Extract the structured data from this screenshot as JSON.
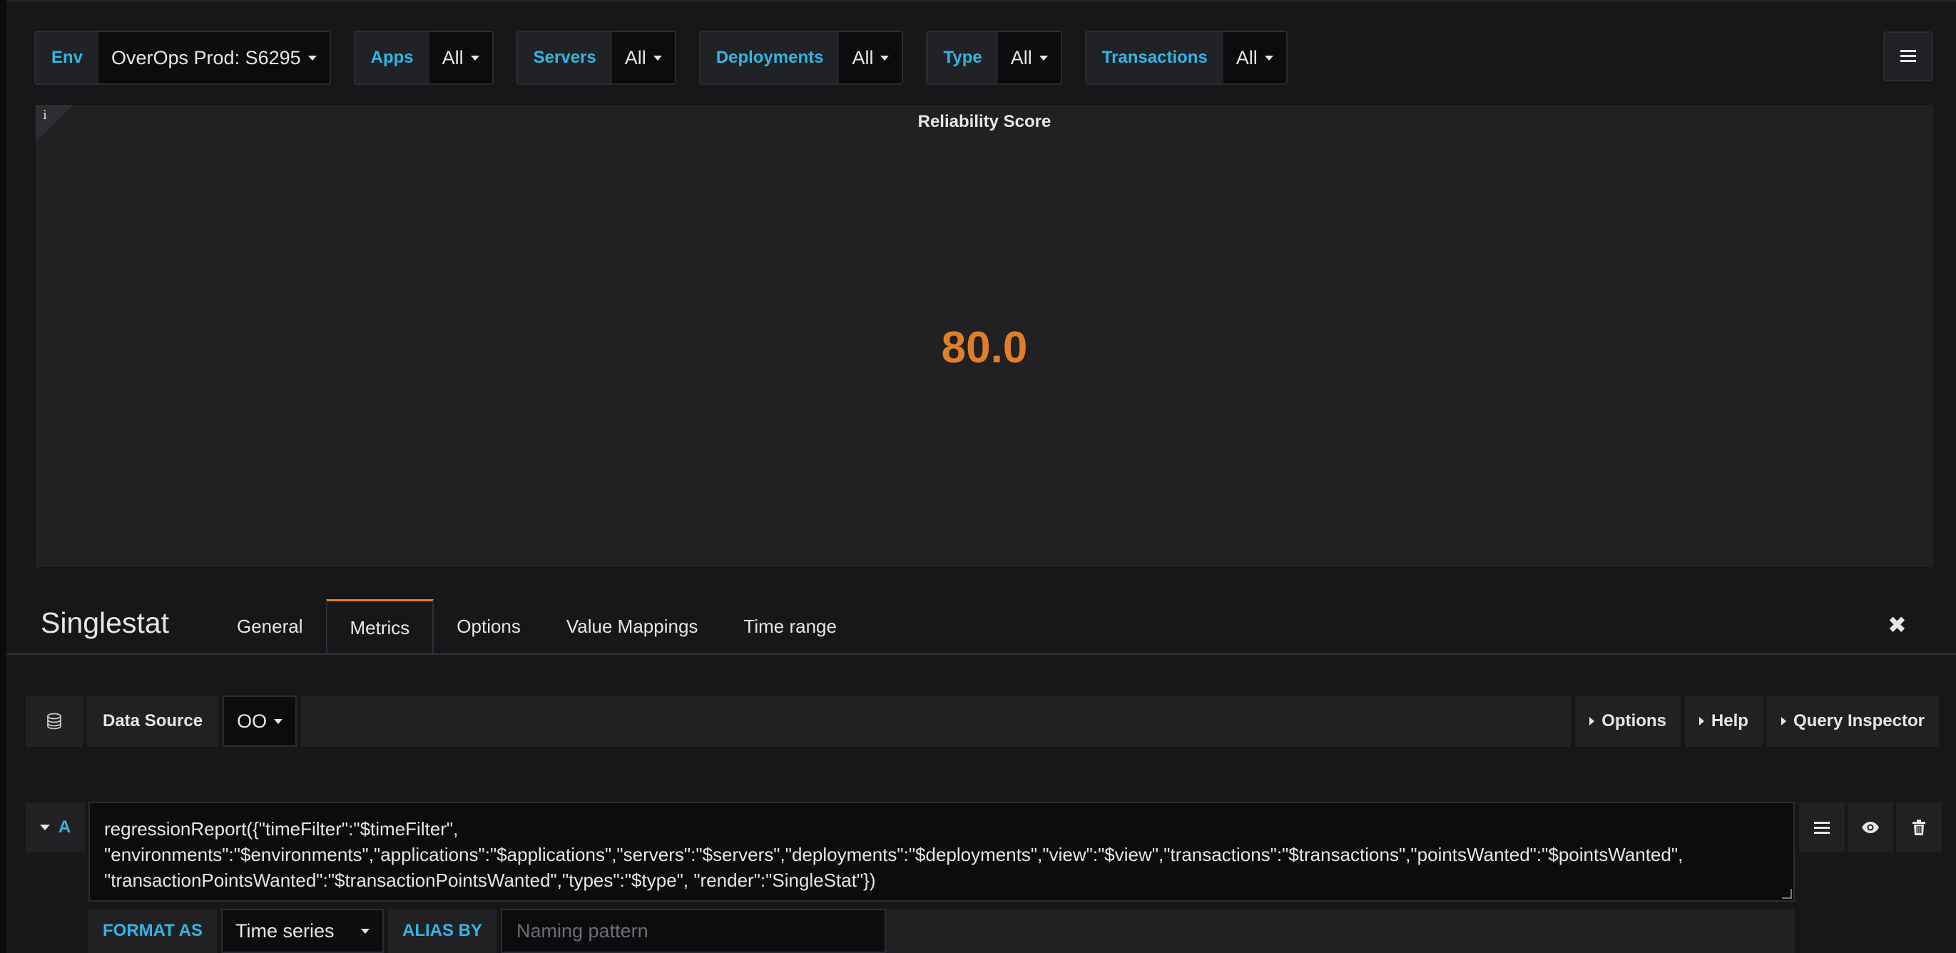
{
  "variables": [
    {
      "label": "Env",
      "value": "OverOps Prod: S6295"
    },
    {
      "label": "Apps",
      "value": "All"
    },
    {
      "label": "Servers",
      "value": "All"
    },
    {
      "label": "Deployments",
      "value": "All"
    },
    {
      "label": "Type",
      "value": "All"
    },
    {
      "label": "Transactions",
      "value": "All"
    }
  ],
  "panel": {
    "info_glyph": "i",
    "title": "Reliability Score",
    "value": "80.0",
    "value_color": "#e07e2c"
  },
  "editor": {
    "title": "Singlestat",
    "tabs": [
      "General",
      "Metrics",
      "Options",
      "Value Mappings",
      "Time range"
    ],
    "active_tab": "Metrics",
    "close_glyph": "✖"
  },
  "datasource": {
    "label": "Data Source",
    "value": "OO",
    "buttons": [
      "Options",
      "Help",
      "Query Inspector"
    ]
  },
  "query": {
    "ref_id": "A",
    "text": "regressionReport({\"timeFilter\":\"$timeFilter\",\n\"environments\":\"$environments\",\"applications\":\"$applications\",\"servers\":\"$servers\",\"deployments\":\"$deployments\",\"view\":\"$view\",\"transactions\":\"$transactions\",\"pointsWanted\":\"$pointsWanted\",\n\"transactionPointsWanted\":\"$transactionPointsWanted\",\"types\":\"$type\", \"render\":\"SingleStat\"})"
  },
  "format": {
    "format_label": "FORMAT AS",
    "format_value": "Time series",
    "alias_label": "ALIAS BY",
    "alias_placeholder": "Naming pattern"
  },
  "colors": {
    "accent_blue": "#33b5e5",
    "tab_accent": "#eb7b18",
    "background": "#161719"
  }
}
